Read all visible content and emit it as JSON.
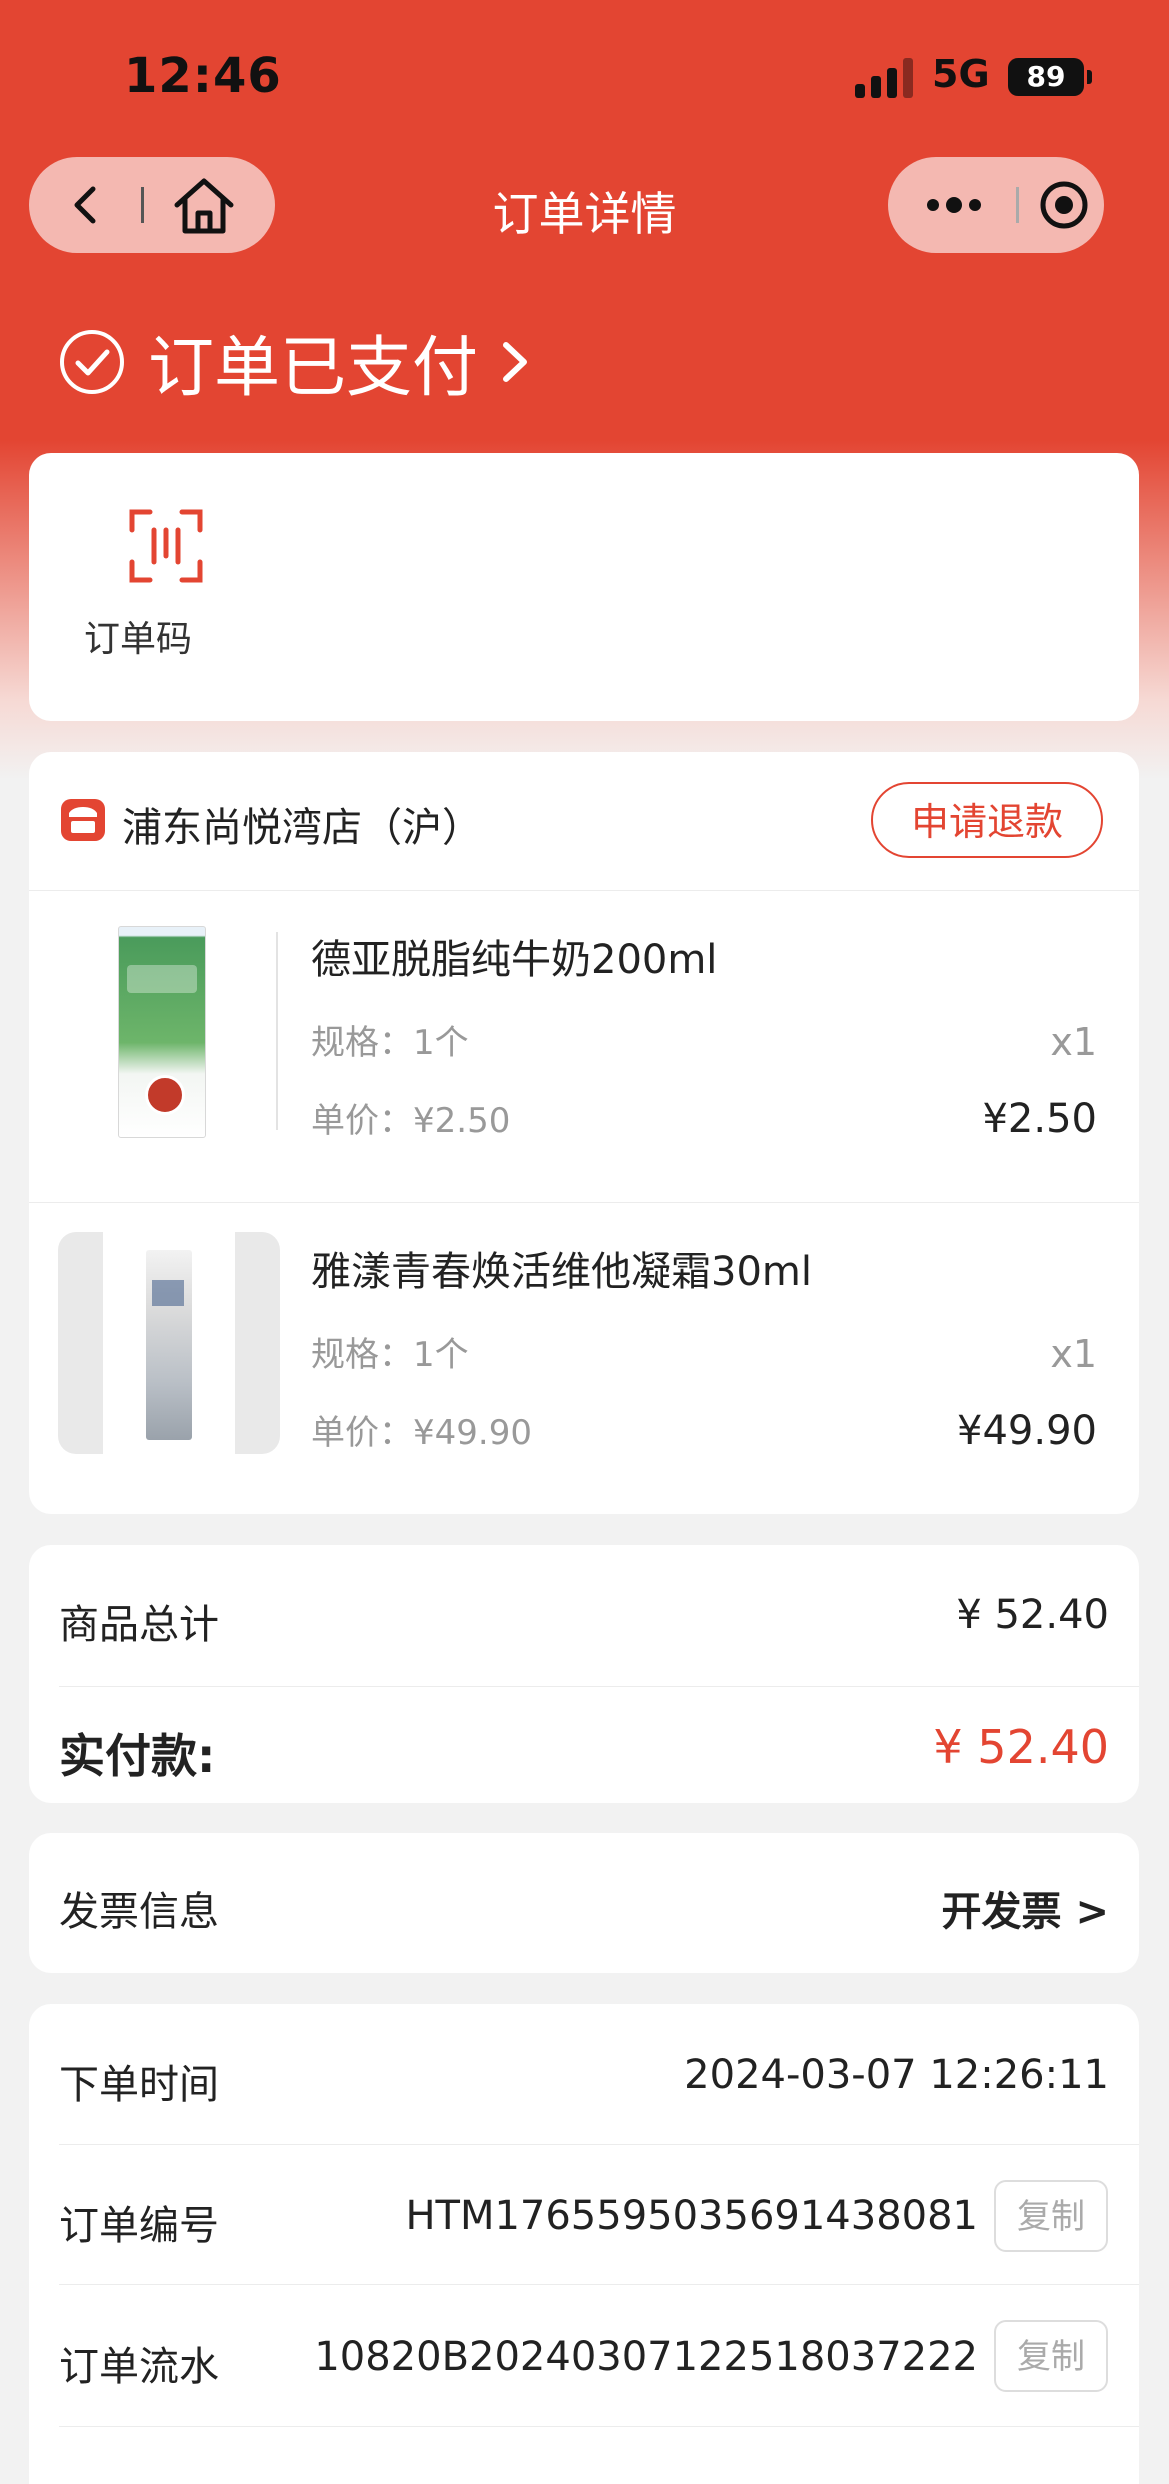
{
  "status_bar": {
    "time": "12:46",
    "network": "5G",
    "battery": "89"
  },
  "nav": {
    "title": "订单详情"
  },
  "order_status": {
    "text": "订单已支付",
    "arrow": ">"
  },
  "order_code": {
    "label": "订单码"
  },
  "store": {
    "name": "浦东尚悦湾店（沪）",
    "refund_label": "申请退款"
  },
  "items": [
    {
      "name": "德亚脱脂纯牛奶200ml",
      "spec": "规格：1个",
      "unit_price": "单价：¥2.50",
      "qty": "x1",
      "total": "¥2.50"
    },
    {
      "name": "雅漾青春焕活维他凝霜30ml",
      "spec": "规格：1个",
      "unit_price": "单价：¥49.90",
      "qty": "x1",
      "total": "¥49.90"
    }
  ],
  "summary": {
    "subtotal_label": "商品总计",
    "subtotal_value": "¥ 52.40",
    "paid_label": "实付款:",
    "paid_value": "¥ 52.40"
  },
  "invoice": {
    "label": "发票信息",
    "action": "开发票 >"
  },
  "details": {
    "order_time_label": "下单时间",
    "order_time_value": "2024-03-07 12:26:11",
    "order_no_label": "订单编号",
    "order_no_value": "HTM1765595035691438081",
    "serial_label": "订单流水",
    "serial_value": "10820B20240307122518037222",
    "copy_label": "复制"
  },
  "colors": {
    "brand": "#e34532",
    "page_bg": "#f2f2f2"
  }
}
